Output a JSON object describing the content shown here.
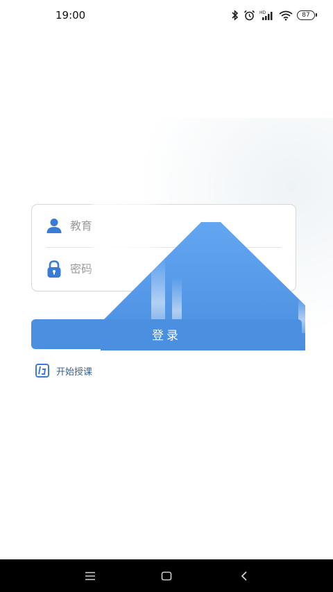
{
  "status_bar": {
    "time": "19:00",
    "battery": "87",
    "icons": [
      "bluetooth-icon",
      "alarm-icon",
      "hd-signal-icon",
      "wifi-icon",
      "battery-icon"
    ]
  },
  "login_form": {
    "account_placeholder": "教育",
    "password_placeholder": "密码",
    "account_icon": "user-icon",
    "password_icon": "lock-icon"
  },
  "login_button": {
    "label": "登录"
  },
  "start_teaching": {
    "label": "开始授课",
    "icon": "teach-logo-icon"
  },
  "nav_bar": {
    "icons": [
      "menu-icon",
      "home-icon",
      "back-icon"
    ]
  },
  "colors": {
    "accent": "#4b8fe0",
    "icon_blue": "#3a7bd5",
    "link_text": "#3a5f8f",
    "border": "#d7d7d7",
    "nav_bg": "#000000"
  }
}
